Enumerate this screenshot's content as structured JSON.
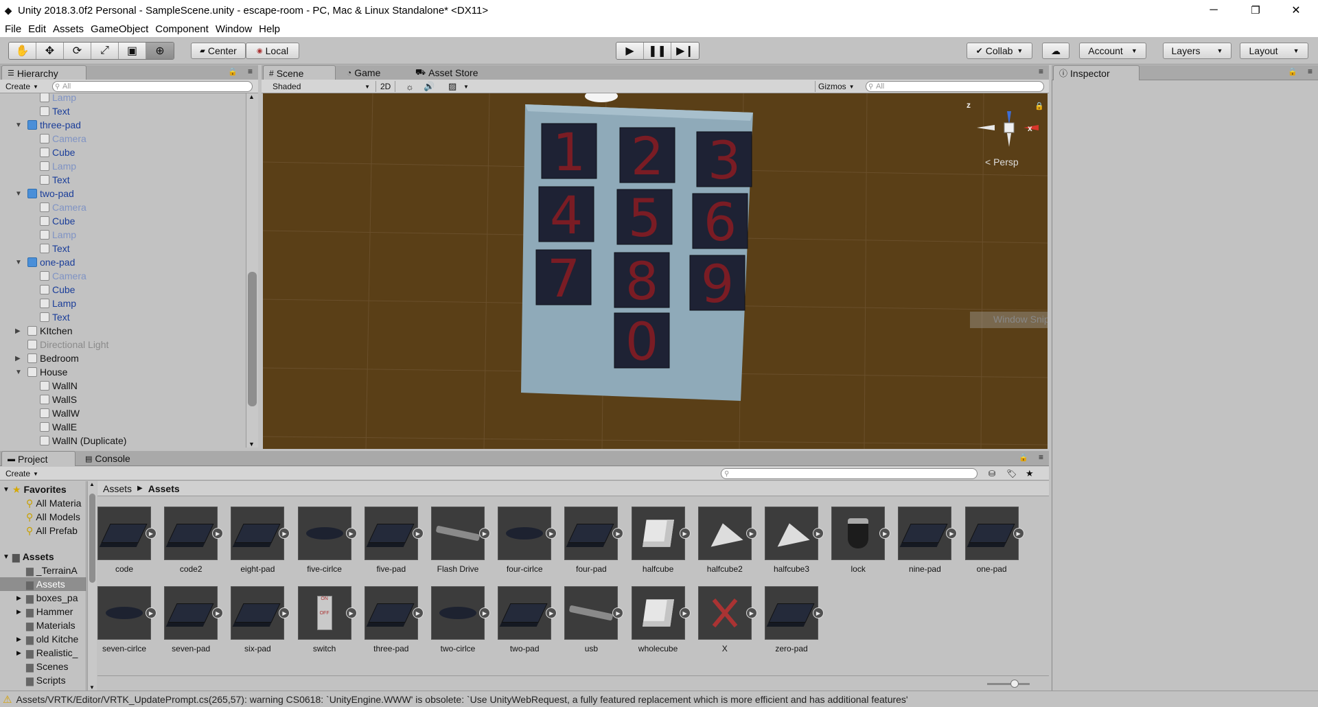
{
  "window": {
    "title": "Unity 2018.3.0f2 Personal - SampleScene.unity - escape-room - PC, Mac & Linux Standalone* <DX11>",
    "minimize": "─",
    "maximize": "❐",
    "close": "✕"
  },
  "menu": [
    "File",
    "Edit",
    "Assets",
    "GameObject",
    "Component",
    "Window",
    "Help"
  ],
  "toolbar": {
    "center_label": "Center",
    "local_label": "Local",
    "collab_label": "Collab",
    "account_label": "Account",
    "layers_label": "Layers",
    "layout_label": "Layout"
  },
  "hierarchy": {
    "tab": "Hierarchy",
    "create": "Create",
    "search_placeholder": "All",
    "rows": [
      {
        "label": "Lamp",
        "style": "dim",
        "level": 2
      },
      {
        "label": "Text",
        "style": "blue",
        "level": 2
      },
      {
        "label": "three-pad",
        "style": "blue",
        "level": 1,
        "expanded": true,
        "prefab": true
      },
      {
        "label": "Camera",
        "style": "dim",
        "level": 2
      },
      {
        "label": "Cube",
        "style": "blue",
        "level": 2
      },
      {
        "label": "Lamp",
        "style": "dim",
        "level": 2
      },
      {
        "label": "Text",
        "style": "blue",
        "level": 2
      },
      {
        "label": "two-pad",
        "style": "blue",
        "level": 1,
        "expanded": true,
        "prefab": true
      },
      {
        "label": "Camera",
        "style": "dim",
        "level": 2
      },
      {
        "label": "Cube",
        "style": "blue",
        "level": 2
      },
      {
        "label": "Lamp",
        "style": "dim",
        "level": 2
      },
      {
        "label": "Text",
        "style": "blue",
        "level": 2
      },
      {
        "label": "one-pad",
        "style": "blue",
        "level": 1,
        "expanded": true,
        "prefab": true
      },
      {
        "label": "Camera",
        "style": "dim",
        "level": 2
      },
      {
        "label": "Cube",
        "style": "blue",
        "level": 2
      },
      {
        "label": "Lamp",
        "style": "blue",
        "level": 2
      },
      {
        "label": "Text",
        "style": "blue",
        "level": 2
      },
      {
        "label": "KItchen",
        "style": "normal",
        "level": 1,
        "expanded": false
      },
      {
        "label": "Directional Light",
        "style": "gray",
        "level": 1
      },
      {
        "label": "Bedroom",
        "style": "normal",
        "level": 1,
        "expanded": false
      },
      {
        "label": "House",
        "style": "normal",
        "level": 1,
        "expanded": true
      },
      {
        "label": "WallN",
        "style": "normal",
        "level": 2
      },
      {
        "label": "WallS",
        "style": "normal",
        "level": 2
      },
      {
        "label": "WallW",
        "style": "normal",
        "level": 2
      },
      {
        "label": "WallE",
        "style": "normal",
        "level": 2
      },
      {
        "label": "WallN (Duplicate)",
        "style": "normal",
        "level": 2
      }
    ]
  },
  "scene": {
    "tabs": [
      "Scene",
      "Game",
      "Asset Store"
    ],
    "shading": "Shaded",
    "mode2d": "2D",
    "gizmos": "Gizmos",
    "search_placeholder": "All",
    "persp": "Persp",
    "axis_z": "z",
    "axis_x": "x",
    "watermark": "Window Snip",
    "keypad": [
      "1",
      "2",
      "3",
      "4",
      "5",
      "6",
      "7",
      "8",
      "9",
      "0"
    ]
  },
  "inspector": {
    "tab": "Inspector"
  },
  "project": {
    "tabs": [
      "Project",
      "Console"
    ],
    "create": "Create",
    "breadcrumb": [
      "Assets",
      "Assets"
    ],
    "favorites_label": "Favorites",
    "favorites": [
      "All Materia",
      "All Models",
      "All Prefab"
    ],
    "assets_label": "Assets",
    "folders": [
      {
        "label": "_TerrainA",
        "expandable": false
      },
      {
        "label": "Assets",
        "expandable": false,
        "selected": true
      },
      {
        "label": "boxes_pa",
        "expandable": true
      },
      {
        "label": "Hammer",
        "expandable": true
      },
      {
        "label": "Materials",
        "expandable": false
      },
      {
        "label": "old Kitche",
        "expandable": true
      },
      {
        "label": "Realistic_",
        "expandable": true
      },
      {
        "label": "Scenes",
        "expandable": false
      },
      {
        "label": "Scripts",
        "expandable": false
      }
    ],
    "items": [
      {
        "label": "code",
        "kind": "pad"
      },
      {
        "label": "code2",
        "kind": "pad"
      },
      {
        "label": "eight-pad",
        "kind": "pad"
      },
      {
        "label": "five-cirlce",
        "kind": "circle"
      },
      {
        "label": "five-pad",
        "kind": "pad"
      },
      {
        "label": "Flash Drive",
        "kind": "drive"
      },
      {
        "label": "four-cirlce",
        "kind": "circle"
      },
      {
        "label": "four-pad",
        "kind": "pad"
      },
      {
        "label": "halfcube",
        "kind": "cube"
      },
      {
        "label": "halfcube2",
        "kind": "half"
      },
      {
        "label": "halfcube3",
        "kind": "half"
      },
      {
        "label": "lock",
        "kind": "lock"
      },
      {
        "label": "nine-pad",
        "kind": "pad"
      },
      {
        "label": "one-pad",
        "kind": "pad"
      },
      {
        "label": "seven-cirlce",
        "kind": "circle"
      },
      {
        "label": "seven-pad",
        "kind": "pad"
      },
      {
        "label": "six-pad",
        "kind": "pad"
      },
      {
        "label": "switch",
        "kind": "switch"
      },
      {
        "label": "three-pad",
        "kind": "pad"
      },
      {
        "label": "two-cirlce",
        "kind": "circle"
      },
      {
        "label": "two-pad",
        "kind": "pad"
      },
      {
        "label": "usb",
        "kind": "drive"
      },
      {
        "label": "wholecube",
        "kind": "cube"
      },
      {
        "label": "X",
        "kind": "x"
      },
      {
        "label": "zero-pad",
        "kind": "pad"
      }
    ]
  },
  "status": {
    "message": "Assets/VRTK/Editor/VRTK_UpdatePrompt.cs(265,57): warning CS0618: `UnityEngine.WWW' is obsolete: `Use UnityWebRequest, a fully featured replacement which is more efficient and has additional features'"
  },
  "colors": {
    "scene_bg": "#5a3f17",
    "key_face": "#1e2234",
    "digit": "#7a1c24",
    "panel": "#c2c2c2",
    "link": "#1a3d99"
  }
}
